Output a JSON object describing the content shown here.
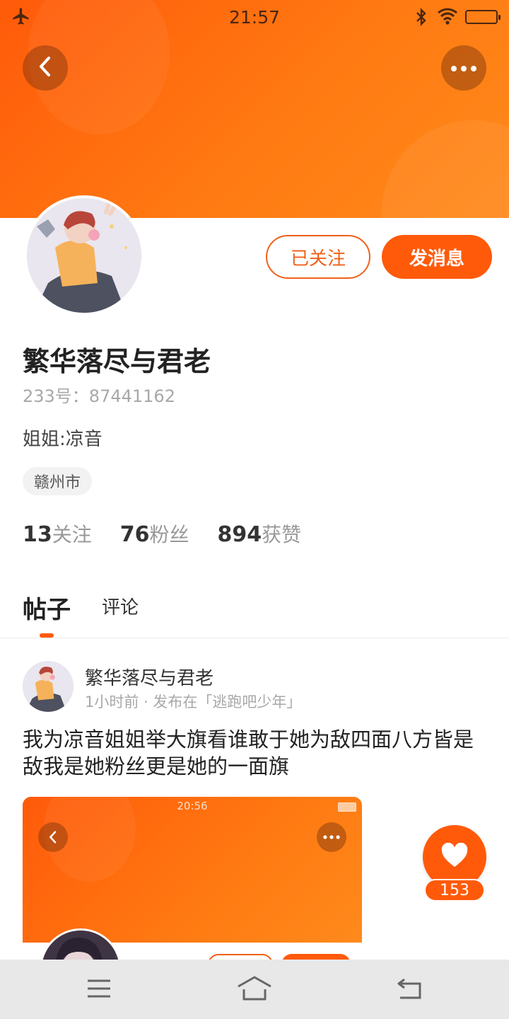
{
  "status_bar": {
    "time": "21:57"
  },
  "header": {
    "back_icon": "chevron-left-icon",
    "more_icon": "more-horizontal-icon"
  },
  "profile": {
    "follow_button": "已关注",
    "message_button": "发消息",
    "username": "繁华落尽与君老",
    "uid": "233号：87441162",
    "bio": "姐姐:凉音",
    "location": "赣州市",
    "stats": [
      {
        "num": "13",
        "label": "关注"
      },
      {
        "num": "76",
        "label": "粉丝"
      },
      {
        "num": "894",
        "label": "获赞"
      }
    ]
  },
  "tabs": {
    "posts": "帖子",
    "comments": "评论"
  },
  "post": {
    "author": "繁华落尽与君老",
    "meta": "1小时前 · 发布在「逃跑吧少年」",
    "text": "我为凉音姐姐举大旗看谁敢于她为敌四面八方皆是敌我是她粉丝更是她的一面旗",
    "image": {
      "time": "20:56"
    },
    "likes": "153"
  },
  "colors": {
    "accent": "#ff5a0a",
    "banner_light": "#ff8a1c"
  }
}
